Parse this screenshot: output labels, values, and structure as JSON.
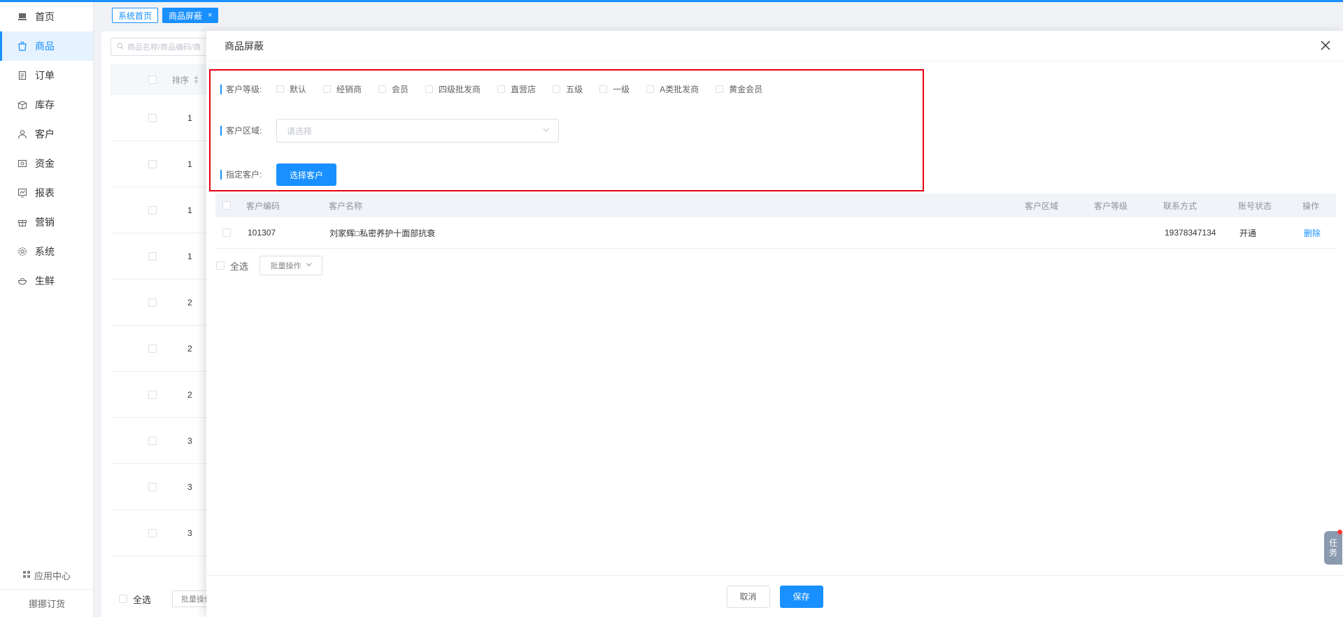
{
  "sidebar": {
    "items": [
      {
        "label": "首页",
        "icon": "monitor-icon",
        "active": false
      },
      {
        "label": "商品",
        "icon": "shopping-bag-icon",
        "active": true
      },
      {
        "label": "订单",
        "icon": "document-icon",
        "active": false
      },
      {
        "label": "库存",
        "icon": "box-icon",
        "active": false
      },
      {
        "label": "客户",
        "icon": "user-icon",
        "active": false
      },
      {
        "label": "资金",
        "icon": "wallet-icon",
        "active": false
      },
      {
        "label": "报表",
        "icon": "chart-icon",
        "active": false
      },
      {
        "label": "营销",
        "icon": "gift-icon",
        "active": false
      },
      {
        "label": "系统",
        "icon": "gear-icon",
        "active": false
      },
      {
        "label": "生鲜",
        "icon": "bowl-icon",
        "active": false
      }
    ],
    "app_center": "应用中心",
    "brand": "挪挪订货"
  },
  "tabs": [
    {
      "label": "系统首页",
      "active": false
    },
    {
      "label": "商品屏蔽",
      "active": true,
      "close": "×"
    }
  ],
  "background": {
    "search_placeholder": "商品名称/商品编码/商",
    "sort_header": "排序",
    "rows": [
      "1",
      "1",
      "1",
      "1",
      "2",
      "2",
      "2",
      "3",
      "3",
      "3"
    ],
    "select_all": "全选",
    "batch": "批量操作"
  },
  "drawer": {
    "title": "商品屏蔽",
    "level_label": "客户等级:",
    "levels": [
      "默认",
      "经销商",
      "会员",
      "四级批发商",
      "直营店",
      "五级",
      "一级",
      "A类批发商",
      "黄金会员"
    ],
    "region_label": "客户区域:",
    "region_placeholder": "请选择",
    "customer_label": "指定客户:",
    "select_customer_btn": "选择客户",
    "table": {
      "headers": {
        "code": "客户编码",
        "name": "客户名称",
        "region": "客户区域",
        "level": "客户等级",
        "contact": "联系方式",
        "status": "账号状态",
        "action": "操作"
      },
      "rows": [
        {
          "code": "101307",
          "name": "刘家辉□私密养护十面部抗衰",
          "region": "",
          "level": "",
          "contact": "19378347134",
          "status": "开通",
          "action": "删除"
        }
      ]
    },
    "select_all": "全选",
    "batch": "批量操作",
    "cancel": "取消",
    "save": "保存"
  },
  "task_widget": {
    "line1": "任",
    "line2": "务"
  },
  "colors": {
    "accent": "#1890ff",
    "highlight": "#e60012"
  }
}
